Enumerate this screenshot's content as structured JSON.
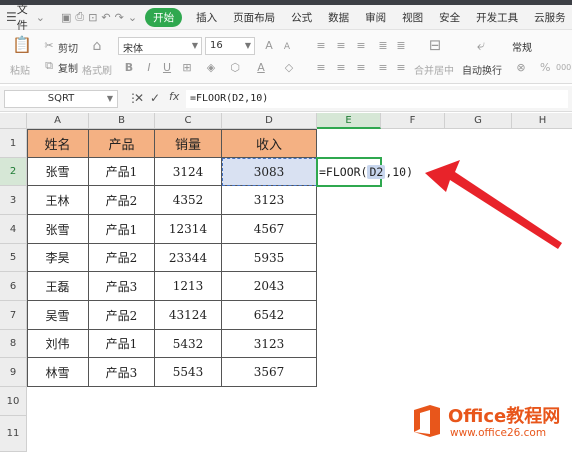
{
  "menubar": {
    "file_label": "文件",
    "tabs": [
      "开始",
      "插入",
      "页面布局",
      "公式",
      "数据",
      "审阅",
      "视图",
      "安全",
      "开发工具",
      "云服务"
    ],
    "active_tab": "开始",
    "accent": "#2fa84f"
  },
  "ribbon": {
    "cut": "剪切",
    "copy": "复制",
    "paste": "粘贴",
    "format_painter": "格式刷",
    "font_name": "宋体",
    "font_size": "16",
    "merge_center": "合并居中",
    "wrap_text": "自动换行",
    "number_format": "常规",
    "percent": "%",
    "thousands": "000"
  },
  "formula_bar": {
    "name_box": "SQRT",
    "formula": "=FLOOR(D2,10)",
    "cancel_icon": "close-icon",
    "enter_icon": "check-icon",
    "fx_label": "fx"
  },
  "columns": [
    "A",
    "B",
    "C",
    "D",
    "E",
    "F",
    "G",
    "H"
  ],
  "rows": [
    "1",
    "2",
    "3",
    "4",
    "5",
    "6",
    "7",
    "8",
    "9",
    "10",
    "11"
  ],
  "table": {
    "headers": [
      "姓名",
      "产品",
      "销量",
      "收入"
    ],
    "header_color": "#f4b183",
    "rows": [
      [
        "张雪",
        "产品1",
        "3124",
        "3083"
      ],
      [
        "王林",
        "产品2",
        "4352",
        "3123"
      ],
      [
        "张雪",
        "产品1",
        "12314",
        "4567"
      ],
      [
        "李昊",
        "产品2",
        "23344",
        "5935"
      ],
      [
        "王磊",
        "产品3",
        "1213",
        "2043"
      ],
      [
        "吴雪",
        "产品2",
        "43124",
        "6542"
      ],
      [
        "刘伟",
        "产品1",
        "5432",
        "3123"
      ],
      [
        "林雪",
        "产品3",
        "5543",
        "3567"
      ]
    ]
  },
  "editing_cell": {
    "prefix": "=FLOOR(",
    "ref": "D2",
    "suffix": ",10)"
  },
  "annotation": {
    "arrow_color": "#e8232a"
  },
  "watermark": {
    "title": "Office教程网",
    "url": "www.office26.com",
    "color": "#e8561b"
  }
}
